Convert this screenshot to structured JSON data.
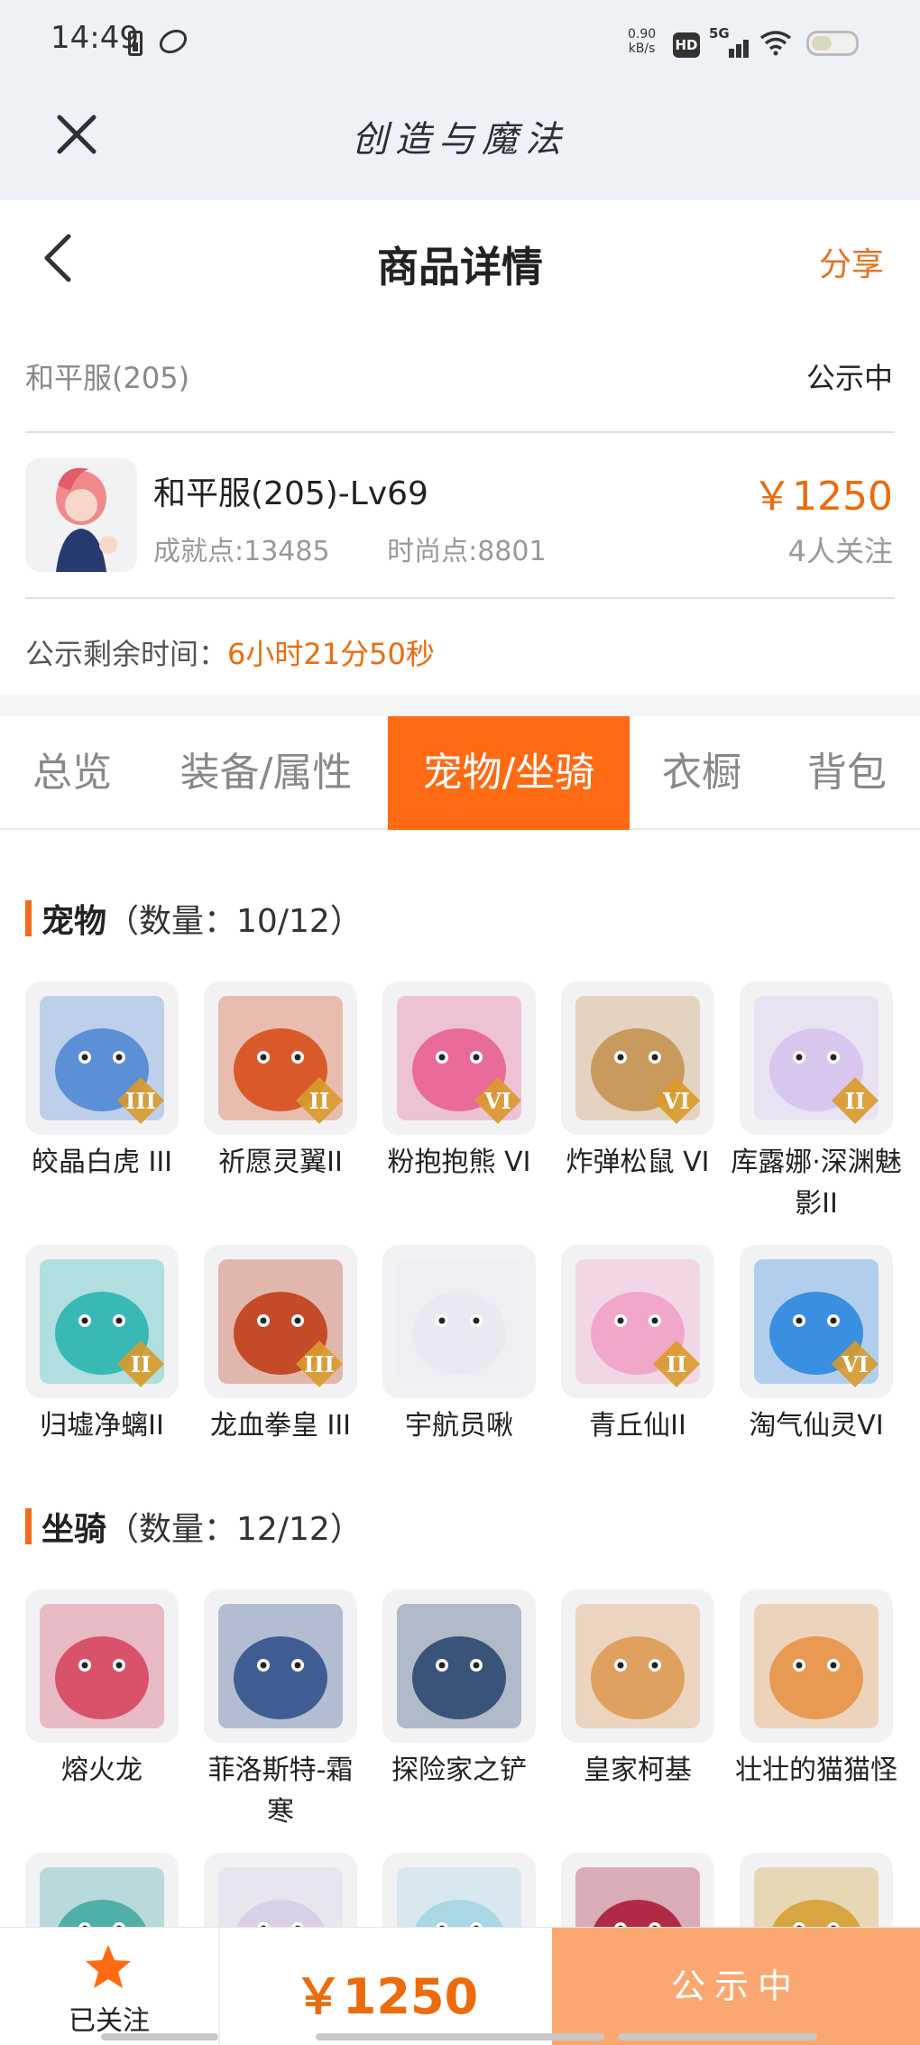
{
  "status_bar": {
    "time": "14:49",
    "net_speed_value": "0.90",
    "net_speed_unit": "kB/s",
    "hd": "HD",
    "network": "5G"
  },
  "app": {
    "title": "创造与魔法"
  },
  "nav": {
    "title": "商品详情",
    "share": "分享"
  },
  "listing": {
    "server": "和平服(205)",
    "status": "公示中",
    "character_name": "和平服(205)-Lv69",
    "achievement": "成就点:13485",
    "fashion": "时尚点:8801",
    "price": "￥1250",
    "followers": "4人关注",
    "remaining_label": "公示剩余时间：",
    "remaining_value": "6小时21分50秒"
  },
  "tabs": [
    {
      "label": "总览",
      "active": false
    },
    {
      "label": "装备/属性",
      "active": false
    },
    {
      "label": "宠物/坐骑",
      "active": true
    },
    {
      "label": "衣橱",
      "active": false
    },
    {
      "label": "背包",
      "active": false
    }
  ],
  "pets": {
    "title": "宠物",
    "count": "（数量：10/12）",
    "items": [
      {
        "name": "皎晶白虎 III",
        "tier": "III",
        "color": "#5b8fd6"
      },
      {
        "name": "祈愿灵翼II",
        "tier": "II",
        "color": "#d85a2a"
      },
      {
        "name": "粉抱抱熊 VI",
        "tier": "VI",
        "color": "#e86b9a"
      },
      {
        "name": "炸弹松鼠 VI",
        "tier": "VI",
        "color": "#c99a5e"
      },
      {
        "name": "库露娜·深渊魅影II",
        "tier": "II",
        "color": "#d9c6ee"
      },
      {
        "name": "归墟净螭II",
        "tier": "II",
        "color": "#38b9b6"
      },
      {
        "name": "龙血拳皇 III",
        "tier": "III",
        "color": "#c44a28"
      },
      {
        "name": "宇航员啾",
        "tier": "",
        "color": "#e9e9f1"
      },
      {
        "name": "青丘仙II",
        "tier": "II",
        "color": "#f1a7c9"
      },
      {
        "name": "淘气仙灵VI",
        "tier": "VI",
        "color": "#3a8fe0"
      }
    ]
  },
  "mounts": {
    "title": "坐骑",
    "count": "（数量：12/12）",
    "items": [
      {
        "name": "熔火龙",
        "color": "#d8526a"
      },
      {
        "name": "菲洛斯特-霜寒",
        "color": "#3f5d92"
      },
      {
        "name": "探险家之铲",
        "color": "#3a5379"
      },
      {
        "name": "皇家柯基",
        "color": "#e0a060"
      },
      {
        "name": "壮壮的猫猫怪",
        "color": "#e89a52"
      }
    ],
    "partial_items": [
      {
        "color": "#4fb0a8"
      },
      {
        "color": "#d9cfe6"
      },
      {
        "color": "#a9d7e3"
      },
      {
        "color": "#b02a45"
      },
      {
        "color": "#d8a640"
      }
    ]
  },
  "bottom": {
    "follow_label": "已关注",
    "price": "￥1250",
    "status": "公示中"
  },
  "colors": {
    "accent": "#ff6a12",
    "price": "#ec6b0c",
    "status_button": "#fba771"
  }
}
